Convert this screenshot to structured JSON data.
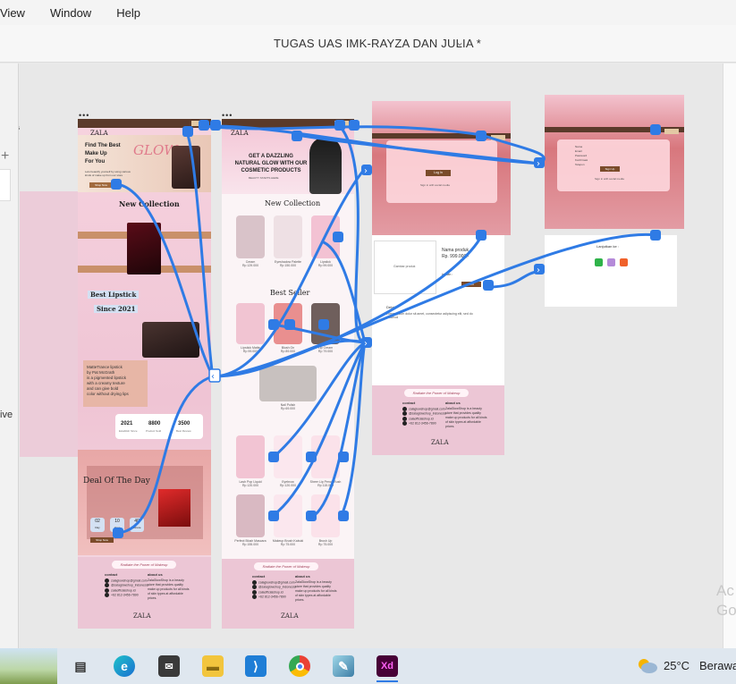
{
  "menu": {
    "items": [
      "View",
      "Window",
      "Help"
    ]
  },
  "document": {
    "title": "TUGAS UAS IMK-RAYZA DAN JULIA *"
  },
  "left_panel": {
    "label": "ame",
    "side_text": "ive"
  },
  "watermark": {
    "line1": "Ac",
    "line2": "Go"
  },
  "colors": {
    "wire": "#2f7be5",
    "brand_brown": "#5a3a2a",
    "pink": "#f2c6d4",
    "swatches": [
      "#f5c3d5",
      "#8a4a1a",
      "#111111",
      "#c9dff5"
    ]
  },
  "artboard1": {
    "logo": "ZALA",
    "logo_sub": "GLOW SHOP",
    "hero_lines": [
      "Find The Best",
      "Make Up",
      "For You"
    ],
    "hero_small": "Lets beautify yourself by using various kinds of make up from our store",
    "hero_btn": "Shop Now",
    "glow": "GLOW",
    "new_collection": "New Collection",
    "best_lipstick": "Best Lipstick",
    "since": "Since 2021",
    "desc": [
      "MatteTrance lipstick",
      "by Pat McGrath",
      "is a pigmented lipstick",
      "with a creamy texture",
      "and can give bold",
      "color without drying lips"
    ],
    "stats": [
      {
        "value": "2021",
        "label": "Establish Since"
      },
      {
        "value": "8800",
        "label": "Product Sold"
      },
      {
        "value": "3500",
        "label": "Best Review"
      }
    ],
    "deal": "Deal Of The Day",
    "countdown": [
      {
        "value": "02",
        "label": "Day"
      },
      {
        "value": "10",
        "label": "Hour"
      },
      {
        "value": "40",
        "label": "Minute"
      }
    ],
    "deal_btn": "Shop Now"
  },
  "artboard2": {
    "hero": [
      "GET A DAZZLING",
      "NATURAL GLOW WITH OUR",
      "COSMETIC PRODUCTS"
    ],
    "hero_small": "BEAUTY STARTS HERE",
    "new_collection": "New Collection",
    "new_items": [
      {
        "name": "Cream",
        "price": "Rp 129.000"
      },
      {
        "name": "Eyeshadow Palette",
        "price": "Rp 150.000"
      },
      {
        "name": "Lipstick",
        "price": "Rp 99.000"
      }
    ],
    "best_seller": "Best Seller",
    "best_items": [
      {
        "name": "Lipstick Matte",
        "price": "Rp 99.000"
      },
      {
        "name": "Blush On",
        "price": "Rp 89.000"
      },
      {
        "name": "Lip Cream",
        "price": "Rp 79.000"
      }
    ],
    "mid_item": {
      "name": "Nail Polish",
      "price": "Rp 69.000"
    },
    "grid_items": [
      {
        "name": "Lash Pop Liquid",
        "price": "Rp 120.000"
      },
      {
        "name": "Eyebrow",
        "price": "Rp 120.000"
      },
      {
        "name": "Sheer Lip Pencil Rush",
        "price": "Rp 115.000"
      },
      {
        "name": "Perfect Blush Mascara",
        "price": "Rp 155.000"
      },
      {
        "name": "Makeup Brush Kabuki",
        "price": "Rp 75.000"
      },
      {
        "name": "Brush Up",
        "price": "Rp 75.000"
      }
    ]
  },
  "artboard3": {
    "login_btn": "Log In",
    "signup_text": "Sign in with social media",
    "product_name": "Nama produk",
    "product_price": "Rp. 999.000,-",
    "image_label": "Gambar produk",
    "qty_label": "jumlah :",
    "buy_btn": "Beli",
    "detail_label": "Detail",
    "detail_text": "Lorem ipsum dolor sit amet, consectetur adipiscing elit, sed do eiusmod"
  },
  "artboard4": {
    "fields": [
      "Nama",
      "Email",
      "Password",
      "Konfirmasi",
      "Telepon"
    ],
    "signup_btn": "Sign Up",
    "social_text": "Sign in with social media",
    "payment_label": "Lanjutkan ke :"
  },
  "footer": {
    "tagline": "Radiate the Power of Makeup",
    "contact_title": "contact",
    "about_title": "about us",
    "contacts": [
      "zalaglowshop@gmail.com",
      "@zalaglowshop_indonesia",
      "zalaofficialshop.id",
      "+62 812-3456-7890"
    ],
    "about": "ZalaGlowShop is a beauty store that provides quality make up products for all kinds of skin types at affordable prices.",
    "logo": "ZALA",
    "logo_sub": "GLOW SHOP"
  },
  "taskbar": {
    "temperature": "25°C",
    "weather": "Berawan"
  }
}
